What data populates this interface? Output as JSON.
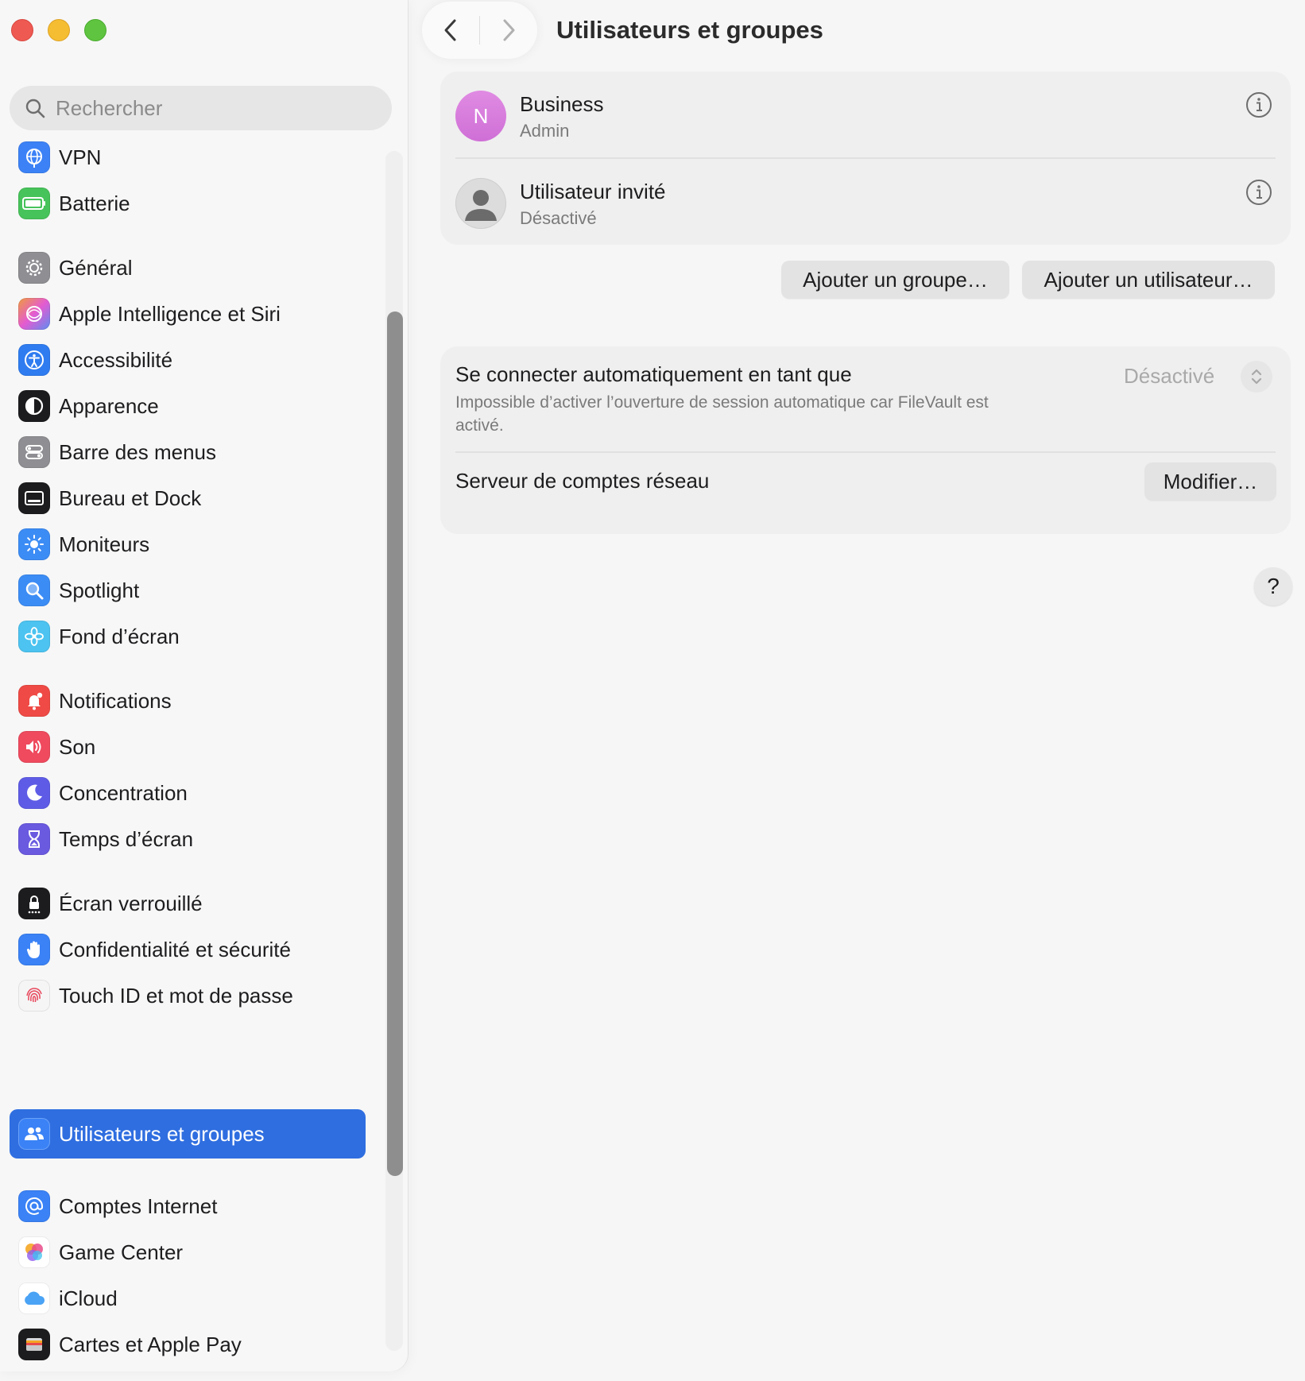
{
  "window": {
    "title": "Utilisateurs et groupes"
  },
  "search": {
    "placeholder": "Rechercher"
  },
  "sidebar": {
    "items": [
      {
        "label": "VPN",
        "icon": "globe-icon",
        "color": "#3c82f6",
        "selected": false
      },
      {
        "label": "Batterie",
        "icon": "battery-icon",
        "color": "#46c35a",
        "selected": false
      },
      {
        "label": "Général",
        "icon": "gear-icon",
        "color": "#8e8e93",
        "selected": false
      },
      {
        "label": "Apple Intelligence et Siri",
        "icon": "siri-icon",
        "color": "#e45bd1",
        "selected": false
      },
      {
        "label": "Accessibilité",
        "icon": "accessibility-icon",
        "color": "#2f7cf0",
        "selected": false
      },
      {
        "label": "Apparence",
        "icon": "appearance-icon",
        "color": "#1c1c1e",
        "selected": false
      },
      {
        "label": "Barre des menus",
        "icon": "menubar-icon",
        "color": "#8e8e93",
        "selected": false
      },
      {
        "label": "Bureau et Dock",
        "icon": "dock-icon",
        "color": "#1c1c1e",
        "selected": false
      },
      {
        "label": "Moniteurs",
        "icon": "sun-icon",
        "color": "#3c8cf5",
        "selected": false
      },
      {
        "label": "Spotlight",
        "icon": "magnifier-icon",
        "color": "#3c8cf5",
        "selected": false
      },
      {
        "label": "Fond d’écran",
        "icon": "flower-icon",
        "color": "#4cc3f0",
        "selected": false
      },
      {
        "label": "Notifications",
        "icon": "bell-icon",
        "color": "#ef4a45",
        "selected": false
      },
      {
        "label": "Son",
        "icon": "speaker-icon",
        "color": "#ef4a5e",
        "selected": false
      },
      {
        "label": "Concentration",
        "icon": "moon-icon",
        "color": "#5e5ce6",
        "selected": false
      },
      {
        "label": "Temps d’écran",
        "icon": "hourglass-icon",
        "color": "#6a5ae0",
        "selected": false
      },
      {
        "label": "Écran verrouillé",
        "icon": "lock-icon",
        "color": "#1c1c1e",
        "selected": false
      },
      {
        "label": "Confidentialité et sécurité",
        "icon": "hand-icon",
        "color": "#3a82f6",
        "selected": false
      },
      {
        "label": "Touch ID et mot de passe",
        "icon": "fingerprint-icon",
        "color": "#f5f5f5",
        "selected": false
      },
      {
        "label": "Utilisateurs et groupes",
        "icon": "users-icon",
        "color": "#3a82f6",
        "selected": true
      },
      {
        "label": "Comptes Internet",
        "icon": "at-icon",
        "color": "#3a82f6",
        "selected": false
      },
      {
        "label": "Game Center",
        "icon": "gamecenter-icon",
        "color": "#ffffff",
        "selected": false
      },
      {
        "label": "iCloud",
        "icon": "cloud-icon",
        "color": "#ffffff",
        "selected": false
      },
      {
        "label": "Cartes et Apple Pay",
        "icon": "wallet-icon",
        "color": "#1c1c1e",
        "selected": false
      }
    ]
  },
  "users": [
    {
      "name": "Business",
      "role": "Admin",
      "avatar_letter": "N",
      "avatar_color": "#d87ddc"
    },
    {
      "name": "Utilisateur invité",
      "role": "Désactivé",
      "avatar_letter": "",
      "avatar_color": "#dcdcdc"
    }
  ],
  "actions": {
    "add_group": "Ajouter un groupe…",
    "add_user": "Ajouter un utilisateur…"
  },
  "auto_login": {
    "label": "Se connecter automatiquement en tant que",
    "description": "Impossible d’activer l’ouverture de session automatique car FileVault est activé.",
    "value": "Désactivé"
  },
  "network_server": {
    "label": "Serveur de comptes réseau",
    "button": "Modifier…"
  },
  "help": {
    "label": "?"
  },
  "colors": {
    "accent": "#2f6ee0",
    "sidebar_bg": "#f7f7f7",
    "card_bg": "#efefef"
  }
}
